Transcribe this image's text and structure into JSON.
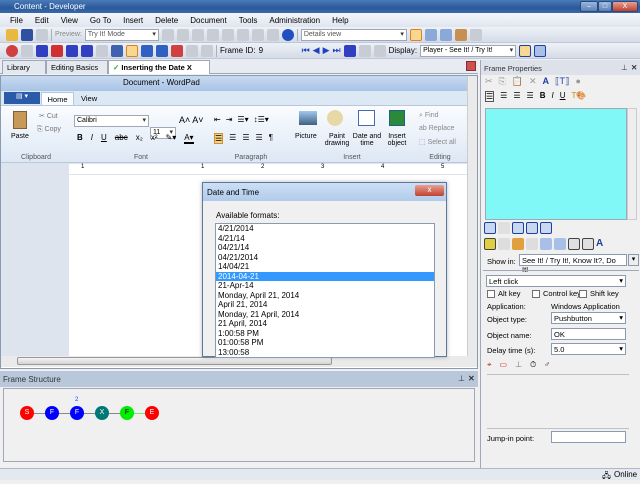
{
  "app": {
    "title": "Content - Developer"
  },
  "menu": [
    "File",
    "Edit",
    "View",
    "Go To",
    "Insert",
    "Delete",
    "Document",
    "Tools",
    "Administration",
    "Help"
  ],
  "toolbar1": {
    "preview_label": "Preview:",
    "preview_mode": "Try It! Mode",
    "view_select": "Details view"
  },
  "toolbar2": {
    "frame_id_label": "Frame ID:",
    "frame_id": "9",
    "display_label": "Display:",
    "display_value": "Player - See It! / Try It!"
  },
  "tabs": [
    {
      "label": "Library"
    },
    {
      "label": "Editing Basics"
    },
    {
      "label": "Inserting the Date",
      "close": "X"
    }
  ],
  "wordpad": {
    "title": "Document - WordPad",
    "tabs": [
      "Home",
      "View"
    ],
    "clipboard": {
      "paste": "Paste",
      "cut": "Cut",
      "copy": "Copy",
      "group": "Clipboard"
    },
    "font": {
      "family": "Calibri",
      "size": "11",
      "group": "Font",
      "bold": "B",
      "italic": "I",
      "underline": "U"
    },
    "paragraph": {
      "group": "Paragraph"
    },
    "insert": {
      "picture": "Picture",
      "paint": "Paint drawing",
      "datetime": "Date and time",
      "object": "Insert object",
      "group": "Insert"
    },
    "editing": {
      "find": "Find",
      "replace": "Replace",
      "select_all": "Select all",
      "group": "Editing"
    },
    "ruler": [
      "1",
      "1",
      "2",
      "3",
      "4",
      "5"
    ]
  },
  "dialog": {
    "title": "Date and Time",
    "close": "x",
    "formats_label": "Available formats:",
    "formats": [
      "4/21/2014",
      "4/21/14",
      "04/21/14",
      "04/21/2014",
      "14/04/21",
      "2014-04-21",
      "21-Apr-14",
      "Monday, April 21, 2014",
      "April 21, 2014",
      "Monday, 21 April, 2014",
      "21 April, 2014",
      "1:00:58 PM",
      "01:00:58 PM",
      "13:00:58"
    ],
    "selected_index": 5
  },
  "frame_structure": {
    "title": "Frame Structure",
    "nodes": [
      {
        "label": "S",
        "color": "#ff0000"
      },
      {
        "label": "F",
        "color": "#0000ff"
      },
      {
        "label": "F",
        "color": "#0000ff",
        "badge": "2"
      },
      {
        "label": "X",
        "color": "#007878"
      },
      {
        "label": "F",
        "color": "#00ee00"
      },
      {
        "label": "E",
        "color": "#ff0000"
      }
    ]
  },
  "frame_properties": {
    "title": "Frame Properties",
    "bubble_color": "#80f8f8",
    "show_in_label": "Show in:",
    "show_in_value": "See It! / Try It!, Know It?, Do It!",
    "action": "Left click",
    "alt_key": "Alt key",
    "control_key": "Control key",
    "shift_key": "Shift key",
    "application_label": "Application:",
    "application_value": "Windows Application",
    "object_type_label": "Object type:",
    "object_type_value": "Pushbutton",
    "object_name_label": "Object name:",
    "object_name_value": "OK",
    "delay_label": "Delay time (s):",
    "delay_value": "5.0",
    "jump_in_label": "Jump-in point:",
    "jump_in_value": ""
  },
  "status": {
    "online": "Online"
  }
}
